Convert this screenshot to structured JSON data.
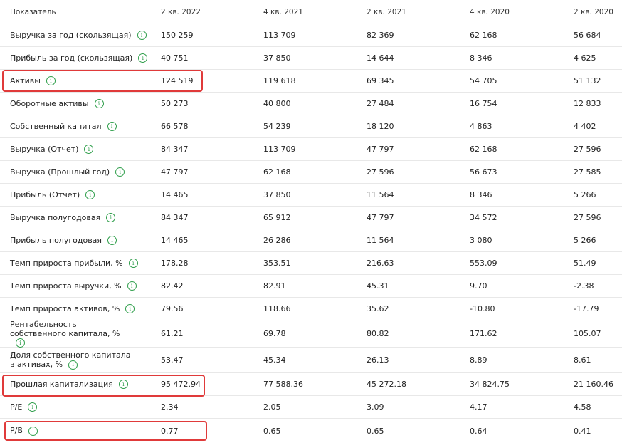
{
  "header": [
    "Показатель",
    "2 кв. 2022",
    "4 кв. 2021",
    "2 кв. 2021",
    "4 кв. 2020",
    "2 кв. 2020"
  ],
  "rows": [
    {
      "label": "Выручка за год (скользящая)",
      "values": [
        "150 259",
        "113 709",
        "82 369",
        "62 168",
        "56 684"
      ]
    },
    {
      "label": "Прибыль за год (скользящая)",
      "values": [
        "40 751",
        "37 850",
        "14 644",
        "8 346",
        "4 625"
      ]
    },
    {
      "label": "Активы",
      "values": [
        "124 519",
        "119 618",
        "69 345",
        "54 705",
        "51 132"
      ]
    },
    {
      "label": "Оборотные активы",
      "values": [
        "50 273",
        "40 800",
        "27 484",
        "16 754",
        "12 833"
      ]
    },
    {
      "label": "Собственный капитал",
      "values": [
        "66 578",
        "54 239",
        "18 120",
        "4 863",
        "4 402"
      ]
    },
    {
      "label": "Выручка (Отчет)",
      "values": [
        "84 347",
        "113 709",
        "47 797",
        "62 168",
        "27 596"
      ]
    },
    {
      "label": "Выручка (Прошлый год)",
      "values": [
        "47 797",
        "62 168",
        "27 596",
        "56 673",
        "27 585"
      ]
    },
    {
      "label": "Прибыль (Отчет)",
      "values": [
        "14 465",
        "37 850",
        "11 564",
        "8 346",
        "5 266"
      ]
    },
    {
      "label": "Выручка полугодовая",
      "values": [
        "84 347",
        "65 912",
        "47 797",
        "34 572",
        "27 596"
      ]
    },
    {
      "label": "Прибыль полугодовая",
      "values": [
        "14 465",
        "26 286",
        "11 564",
        "3 080",
        "5 266"
      ]
    },
    {
      "label": "Темп прироста прибыли, %",
      "values": [
        "178.28",
        "353.51",
        "216.63",
        "553.09",
        "51.49"
      ]
    },
    {
      "label": "Темп прироста выручки, %",
      "values": [
        "82.42",
        "82.91",
        "45.31",
        "9.70",
        "-2.38"
      ]
    },
    {
      "label": "Темп прироста активов, %",
      "values": [
        "79.56",
        "118.66",
        "35.62",
        "-10.80",
        "-17.79"
      ]
    },
    {
      "label": "Рентабельность собственного капитала, %",
      "values": [
        "61.21",
        "69.78",
        "80.82",
        "171.62",
        "105.07"
      ]
    },
    {
      "label": "Доля собственного капитала в активах, %",
      "values": [
        "53.47",
        "45.34",
        "26.13",
        "8.89",
        "8.61"
      ]
    },
    {
      "label": "Прошлая капитализация",
      "values": [
        "95 472.94",
        "77 588.36",
        "45 272.18",
        "34 824.75",
        "21 160.46"
      ]
    },
    {
      "label": "P/E",
      "values": [
        "2.34",
        "2.05",
        "3.09",
        "4.17",
        "4.58"
      ]
    },
    {
      "label": "P/B",
      "values": [
        "0.77",
        "0.65",
        "0.65",
        "0.64",
        "0.41"
      ]
    }
  ],
  "info_icon_glyph": "i",
  "colors": {
    "info_icon": "#2e9e4a",
    "highlight": "#e03a3a"
  }
}
